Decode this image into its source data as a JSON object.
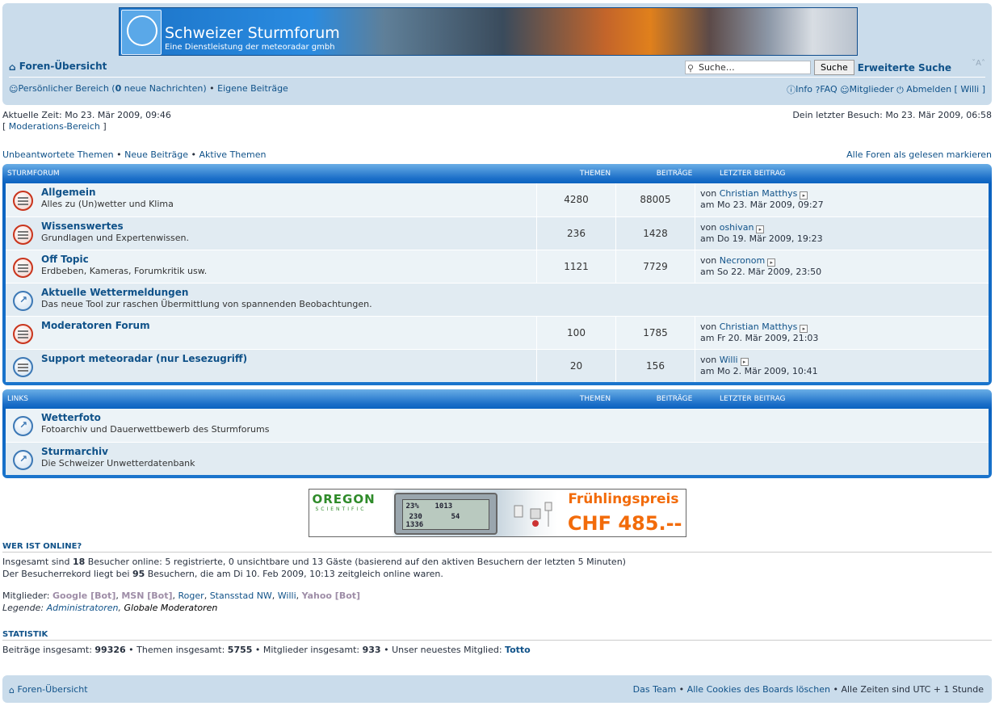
{
  "header": {
    "site_title": "Schweizer Sturmforum",
    "site_subtitle": "Eine Dienstleistung der meteoradar gmbh",
    "home_link": "Foren-Übersicht",
    "search_placeholder": "Suche…",
    "search_button": "Suche",
    "advanced_search": "Erweiterte Suche",
    "font_size": "A",
    "personal_area_prefix": "Persönlicher Bereich (",
    "new_messages_count": "0",
    "personal_area_suffix": " neue Nachrichten)",
    "own_posts": "Eigene Beiträge",
    "info": "Info",
    "faq": "FAQ",
    "members": "Mitglieder",
    "logout": "Abmelden [ Willi ]"
  },
  "info_bar": {
    "current_time": "Aktuelle Zeit: Mo 23. Mär 2009, 09:46",
    "last_visit": "Dein letzter Besuch: Mo 23. Mär 2009, 06:58",
    "moderation": "Moderations-Bereich"
  },
  "actions": {
    "unanswered": "Unbeantwortete Themen",
    "new_posts": "Neue Beiträge",
    "active": "Aktive Themen",
    "mark_read": "Alle Foren als gelesen markieren"
  },
  "columns": {
    "topics": "Themen",
    "posts": "Beiträge",
    "last_post": "Letzter Beitrag"
  },
  "categories": [
    {
      "name": "Sturmforum",
      "forums": [
        {
          "name": "Allgemein",
          "desc": "Alles zu (Un)wetter und Klima",
          "topics": "4280",
          "posts": "88005",
          "by": "von",
          "author": "Christian Matthys",
          "date": "am Mo 23. Mär 2009, 09:27",
          "icon": "forum-unread"
        },
        {
          "name": "Wissenswertes",
          "desc": "Grundlagen und Expertenwissen.",
          "topics": "236",
          "posts": "1428",
          "by": "von",
          "author": "oshivan",
          "date": "am Do 19. Mär 2009, 19:23",
          "icon": "forum-unread"
        },
        {
          "name": "Off Topic",
          "desc": "Erdbeben, Kameras, Forumkritik usw.",
          "topics": "1121",
          "posts": "7729",
          "by": "von",
          "author": "Necronom",
          "date": "am So 22. Mär 2009, 23:50",
          "icon": "forum-unread"
        },
        {
          "name": "Aktuelle Wettermeldungen",
          "desc": "Das neue Tool zur raschen Übermittlung von spannenden Beobachtungen.",
          "icon": "forum-link"
        },
        {
          "name": "Moderatoren Forum",
          "desc": "",
          "topics": "100",
          "posts": "1785",
          "by": "von",
          "author": "Christian Matthys",
          "date": "am Fr 20. Mär 2009, 21:03",
          "icon": "forum-unread"
        },
        {
          "name": "Support meteoradar (nur Lesezugriff)",
          "desc": "",
          "topics": "20",
          "posts": "156",
          "by": "von",
          "author": "Willi",
          "date": "am Mo 2. Mär 2009, 10:41",
          "icon": "forum-read"
        }
      ]
    },
    {
      "name": "Links",
      "forums": [
        {
          "name": "Wetterfoto",
          "desc": "Fotoarchiv und Dauerwettbewerb des Sturmforums",
          "icon": "forum-link"
        },
        {
          "name": "Sturmarchiv",
          "desc": "Die Schweizer Unwetterdatenbank",
          "icon": "forum-link"
        }
      ]
    }
  ],
  "ad": {
    "brand": "OREGON",
    "brand_sub": "SCIENTIFIC",
    "headline": "Frühlingspreis",
    "price": "CHF 485.--"
  },
  "online": {
    "heading": "Wer ist online?",
    "line1_a": "Insgesamt sind ",
    "line1_count": "18",
    "line1_b": " Besucher online: 5 registrierte, 0 unsichtbare und 13 Gäste (basierend auf den aktiven Besuchern der letzten 5 Minuten)",
    "line2_a": "Der Besucherrekord liegt bei ",
    "line2_count": "95",
    "line2_b": " Besuchern, die am Di 10. Feb 2009, 10:13 zeitgleich online waren.",
    "members_label": "Mitglieder: ",
    "members": [
      "Google [Bot]",
      "MSN [Bot]",
      "Roger",
      "Stansstad NW",
      "Willi",
      "Yahoo [Bot]"
    ],
    "legend_label": "Legende: ",
    "legend_admin": "Administratoren",
    "legend_mod": "Globale Moderatoren"
  },
  "stats": {
    "heading": "Statistik",
    "posts_label": "Beiträge insgesamt: ",
    "posts": "99326",
    "topics_label": "Themen insgesamt: ",
    "topics": "5755",
    "members_label": "Mitglieder insgesamt: ",
    "members": "933",
    "newest_label": "Unser neuestes Mitglied: ",
    "newest": "Totto"
  },
  "footer": {
    "home": "Foren-Übersicht",
    "team": "Das Team",
    "cookies": "Alle Cookies des Boards löschen",
    "timezone": "Alle Zeiten sind UTC + 1 Stunde"
  }
}
